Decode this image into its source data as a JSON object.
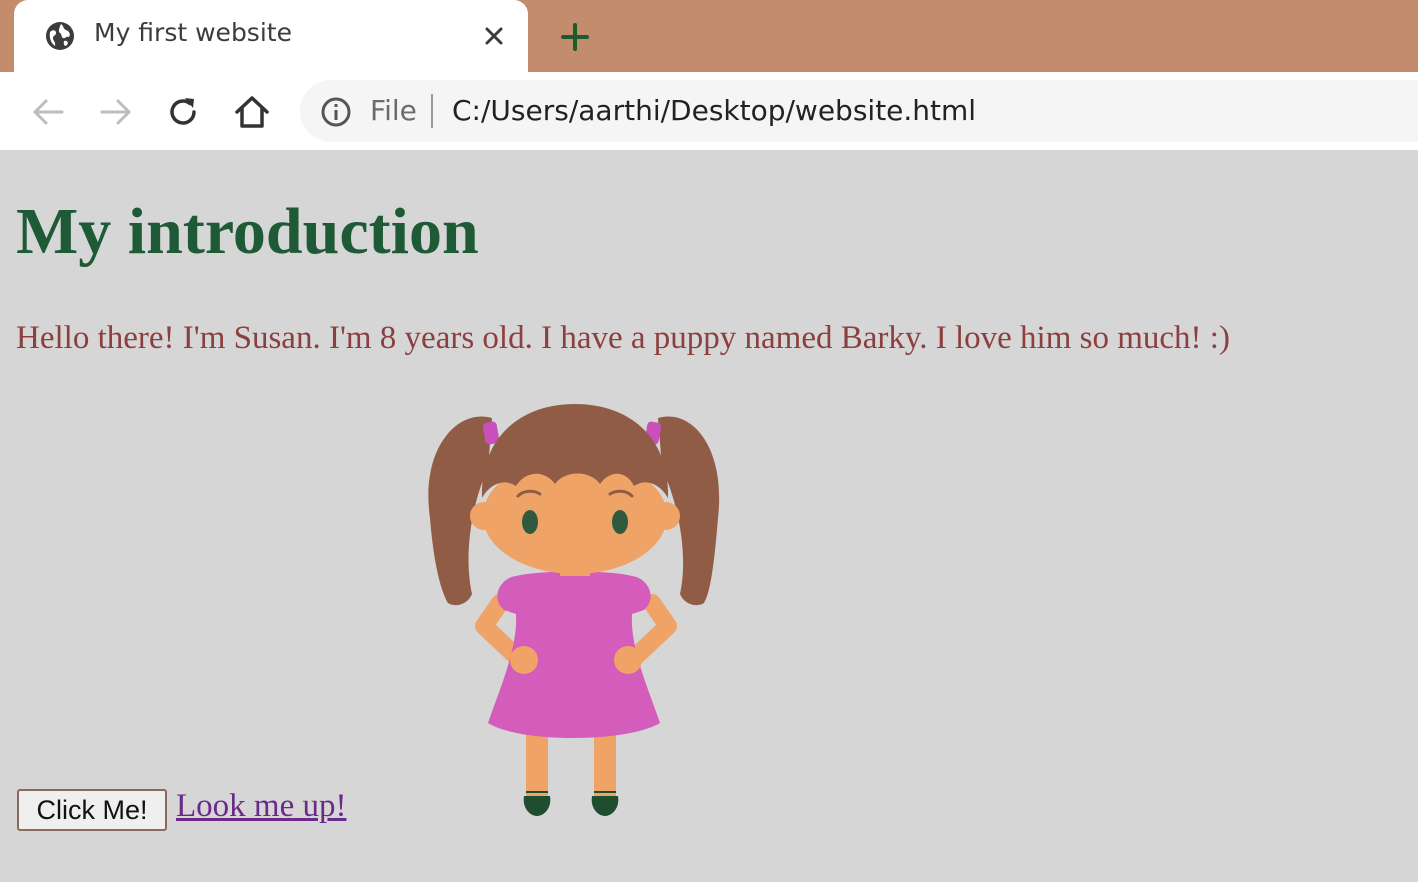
{
  "browser": {
    "tab": {
      "title": "My first website",
      "favicon": "globe-icon"
    },
    "new_tab_icon": "plus-icon",
    "toolbar": {
      "back_icon": "arrow-left-icon",
      "forward_icon": "arrow-right-icon",
      "reload_icon": "reload-icon",
      "home_icon": "home-icon"
    },
    "omnibox": {
      "info_icon": "info-icon",
      "scheme_label": "File",
      "url": "C:/Users/aarthi/Desktop/website.html"
    },
    "colors": {
      "tabstrip": "#c38d6d",
      "page_background": "#d6d6d6"
    }
  },
  "page": {
    "heading": "My introduction",
    "intro": "Hello there! I'm Susan. I'm 8 years old. I have a puppy named Barky. I love him so much! :)",
    "image": "cartoon-girl-illustration",
    "button_label": "Click Me!",
    "link_text": "Look me up!",
    "colors": {
      "heading": "#1f5a37",
      "intro_text": "#8b3f3f",
      "link": "#6b2a8a"
    }
  }
}
